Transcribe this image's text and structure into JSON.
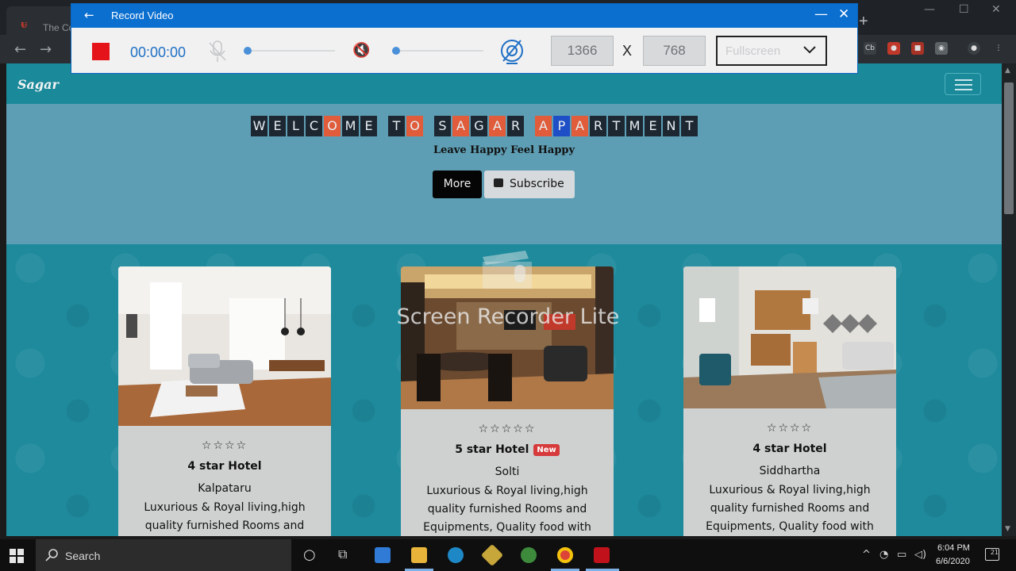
{
  "browser": {
    "tab_title": "The Cor",
    "new_tab": "+"
  },
  "recorder": {
    "title": "Record Video",
    "timer": "00:00:00",
    "width": "1366",
    "x": "X",
    "height": "768",
    "mode": "Fullscreen",
    "mic_level": 0.0,
    "speaker_level": 0.0
  },
  "site": {
    "brand": "Sagar",
    "welcome": [
      {
        "ch": "W",
        "c": "dark"
      },
      {
        "ch": "E",
        "c": "dark"
      },
      {
        "ch": "L",
        "c": "dark"
      },
      {
        "ch": "C",
        "c": "dark"
      },
      {
        "ch": "O",
        "c": "red"
      },
      {
        "ch": "M",
        "c": "dark"
      },
      {
        "ch": "E",
        "c": "dark"
      },
      {
        "ch": "T",
        "c": "dark"
      },
      {
        "ch": "O",
        "c": "red"
      },
      {
        "ch": "S",
        "c": "dark"
      },
      {
        "ch": "A",
        "c": "red"
      },
      {
        "ch": "G",
        "c": "dark"
      },
      {
        "ch": "A",
        "c": "red"
      },
      {
        "ch": "R",
        "c": "dark"
      },
      {
        "ch": "A",
        "c": "red"
      },
      {
        "ch": "P",
        "c": "blue"
      },
      {
        "ch": "A",
        "c": "red"
      },
      {
        "ch": "R",
        "c": "dark"
      },
      {
        "ch": "T",
        "c": "dark"
      },
      {
        "ch": "M",
        "c": "dark"
      },
      {
        "ch": "E",
        "c": "dark"
      },
      {
        "ch": "N",
        "c": "dark"
      },
      {
        "ch": "T",
        "c": "dark"
      }
    ],
    "tagline": "Leave Happy Feel Happy",
    "more_button": "More",
    "subscribe_button": "Subscribe",
    "cards": [
      {
        "stars": "☆☆☆☆",
        "title": "4 star Hotel",
        "badge": "",
        "name": "Kalpataru",
        "desc": "Luxurious & Royal living,high quality furnished Rooms and"
      },
      {
        "stars": "☆☆☆☆☆",
        "title": "5 star Hotel",
        "badge": "New",
        "name": "Solti",
        "desc": "Luxurious & Royal living,high quality furnished Rooms and Equipments, Quality food with"
      },
      {
        "stars": "☆☆☆☆",
        "title": "4 star Hotel",
        "badge": "",
        "name": "Siddhartha",
        "desc": "Luxurious & Royal living,high quality furnished Rooms and Equipments, Quality food with"
      }
    ]
  },
  "watermark": "Screen Recorder Lite",
  "taskbar": {
    "search_placeholder": "Search",
    "time": "6:04 PM",
    "date": "6/6/2020",
    "notifications": "21"
  },
  "colors": {
    "accent": "#0b6fd0",
    "stop": "#e5141b",
    "letter_red": "#e05c3a",
    "letter_blue": "#1f4fc6",
    "teal": "#1f8596"
  }
}
